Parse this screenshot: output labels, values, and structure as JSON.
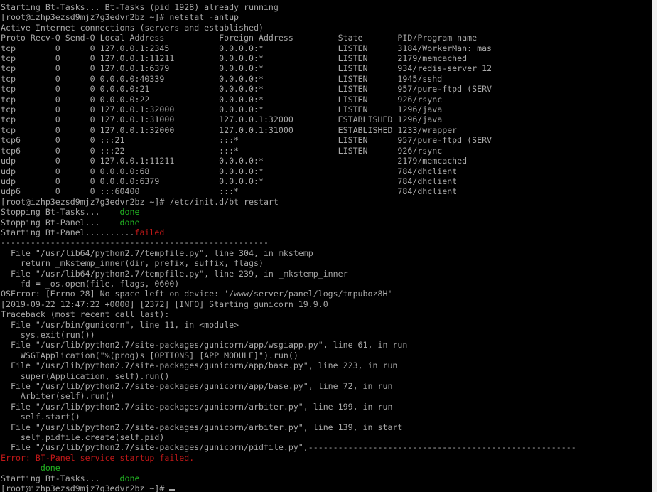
{
  "colors": {
    "background": "#000000",
    "default_text": "#a8a8a8",
    "green": "#22b222",
    "red": "#c01818"
  },
  "terminal": {
    "lines": [
      {
        "segments": [
          {
            "text": "Starting Bt-Tasks... Bt-Tasks (pid 1928) already running",
            "color": "default"
          }
        ]
      },
      {
        "segments": [
          {
            "text": "[root@izhp3ezsd9mjz7g3edvr2bz ~]# netstat -antup",
            "color": "default"
          }
        ]
      },
      {
        "segments": [
          {
            "text": "Active Internet connections (servers and established)",
            "color": "default"
          }
        ]
      },
      {
        "segments": [
          {
            "text": "Proto Recv-Q Send-Q Local Address           Foreign Address         State       PID/Program name",
            "color": "default"
          }
        ]
      },
      {
        "segments": [
          {
            "text": "tcp        0      0 127.0.0.1:2345          0.0.0.0:*               LISTEN      3184/WorkerMan: mas",
            "color": "default"
          }
        ]
      },
      {
        "segments": [
          {
            "text": "tcp        0      0 127.0.0.1:11211         0.0.0.0:*               LISTEN      2179/memcached",
            "color": "default"
          }
        ]
      },
      {
        "segments": [
          {
            "text": "tcp        0      0 127.0.0.1:6379          0.0.0.0:*               LISTEN      934/redis-server 12",
            "color": "default"
          }
        ]
      },
      {
        "segments": [
          {
            "text": "tcp        0      0 0.0.0.0:40339           0.0.0.0:*               LISTEN      1945/sshd",
            "color": "default"
          }
        ]
      },
      {
        "segments": [
          {
            "text": "tcp        0      0 0.0.0.0:21              0.0.0.0:*               LISTEN      957/pure-ftpd (SERV",
            "color": "default"
          }
        ]
      },
      {
        "segments": [
          {
            "text": "tcp        0      0 0.0.0.0:22              0.0.0.0:*               LISTEN      926/rsync",
            "color": "default"
          }
        ]
      },
      {
        "segments": [
          {
            "text": "tcp        0      0 127.0.0.1:32000         0.0.0.0:*               LISTEN      1296/java",
            "color": "default"
          }
        ]
      },
      {
        "segments": [
          {
            "text": "tcp        0      0 127.0.0.1:31000         127.0.0.1:32000         ESTABLISHED 1296/java",
            "color": "default"
          }
        ]
      },
      {
        "segments": [
          {
            "text": "tcp        0      0 127.0.0.1:32000         127.0.0.1:31000         ESTABLISHED 1233/wrapper",
            "color": "default"
          }
        ]
      },
      {
        "segments": [
          {
            "text": "tcp6       0      0 :::21                   :::*                    LISTEN      957/pure-ftpd (SERV",
            "color": "default"
          }
        ]
      },
      {
        "segments": [
          {
            "text": "tcp6       0      0 :::22                   :::*                    LISTEN      926/rsync",
            "color": "default"
          }
        ]
      },
      {
        "segments": [
          {
            "text": "udp        0      0 127.0.0.1:11211         0.0.0.0:*                           2179/memcached",
            "color": "default"
          }
        ]
      },
      {
        "segments": [
          {
            "text": "udp        0      0 0.0.0.0:68              0.0.0.0:*                           784/dhclient",
            "color": "default"
          }
        ]
      },
      {
        "segments": [
          {
            "text": "udp        0      0 0.0.0.0:6379            0.0.0.0:*                           784/dhclient",
            "color": "default"
          }
        ]
      },
      {
        "segments": [
          {
            "text": "udp6       0      0 :::60400                :::*                                784/dhclient",
            "color": "default"
          }
        ]
      },
      {
        "segments": [
          {
            "text": "[root@izhp3ezsd9mjz7g3edvr2bz ~]# /etc/init.d/bt restart",
            "color": "default"
          }
        ]
      },
      {
        "segments": [
          {
            "text": "Stopping Bt-Tasks...    ",
            "color": "default"
          },
          {
            "text": "done",
            "color": "green"
          }
        ]
      },
      {
        "segments": [
          {
            "text": "Stopping Bt-Panel...    ",
            "color": "default"
          },
          {
            "text": "done",
            "color": "green"
          }
        ]
      },
      {
        "segments": [
          {
            "text": "Starting Bt-Panel..........",
            "color": "default"
          },
          {
            "text": "failed",
            "color": "red"
          }
        ]
      },
      {
        "segments": [
          {
            "text": "------------------------------------------------------",
            "color": "default"
          }
        ]
      },
      {
        "segments": [
          {
            "text": "  File \"/usr/lib64/python2.7/tempfile.py\", line 304, in mkstemp",
            "color": "default"
          }
        ]
      },
      {
        "segments": [
          {
            "text": "    return _mkstemp_inner(dir, prefix, suffix, flags)",
            "color": "default"
          }
        ]
      },
      {
        "segments": [
          {
            "text": "  File \"/usr/lib64/python2.7/tempfile.py\", line 239, in _mkstemp_inner",
            "color": "default"
          }
        ]
      },
      {
        "segments": [
          {
            "text": "    fd = _os.open(file, flags, 0600)",
            "color": "default"
          }
        ]
      },
      {
        "segments": [
          {
            "text": "OSError: [Errno 28] No space left on device: '/www/server/panel/logs/tmpuboz8H'",
            "color": "default"
          }
        ]
      },
      {
        "segments": [
          {
            "text": "[2019-09-22 12:47:22 +0000] [2372] [INFO] Starting gunicorn 19.9.0",
            "color": "default"
          }
        ]
      },
      {
        "segments": [
          {
            "text": "Traceback (most recent call last):",
            "color": "default"
          }
        ]
      },
      {
        "segments": [
          {
            "text": "  File \"/usr/bin/gunicorn\", line 11, in <module>",
            "color": "default"
          }
        ]
      },
      {
        "segments": [
          {
            "text": "    sys.exit(run())",
            "color": "default"
          }
        ]
      },
      {
        "segments": [
          {
            "text": "  File \"/usr/lib/python2.7/site-packages/gunicorn/app/wsgiapp.py\", line 61, in run",
            "color": "default"
          }
        ]
      },
      {
        "segments": [
          {
            "text": "    WSGIApplication(\"%(prog)s [OPTIONS] [APP_MODULE]\").run()",
            "color": "default"
          }
        ]
      },
      {
        "segments": [
          {
            "text": "  File \"/usr/lib/python2.7/site-packages/gunicorn/app/base.py\", line 223, in run",
            "color": "default"
          }
        ]
      },
      {
        "segments": [
          {
            "text": "    super(Application, self).run()",
            "color": "default"
          }
        ]
      },
      {
        "segments": [
          {
            "text": "  File \"/usr/lib/python2.7/site-packages/gunicorn/app/base.py\", line 72, in run",
            "color": "default"
          }
        ]
      },
      {
        "segments": [
          {
            "text": "    Arbiter(self).run()",
            "color": "default"
          }
        ]
      },
      {
        "segments": [
          {
            "text": "  File \"/usr/lib/python2.7/site-packages/gunicorn/arbiter.py\", line 199, in run",
            "color": "default"
          }
        ]
      },
      {
        "segments": [
          {
            "text": "    self.start()",
            "color": "default"
          }
        ]
      },
      {
        "segments": [
          {
            "text": "  File \"/usr/lib/python2.7/site-packages/gunicorn/arbiter.py\", line 139, in start",
            "color": "default"
          }
        ]
      },
      {
        "segments": [
          {
            "text": "    self.pidfile.create(self.pid)",
            "color": "default"
          }
        ]
      },
      {
        "segments": [
          {
            "text": "  File \"/usr/lib/python2.7/site-packages/gunicorn/pidfile.py\",------------------------------------------------------",
            "color": "default"
          }
        ]
      },
      {
        "segments": [
          {
            "text": "Error: BT-Panel service startup failed.",
            "color": "red"
          }
        ]
      },
      {
        "segments": [
          {
            "text": "        done",
            "color": "green"
          }
        ]
      },
      {
        "segments": [
          {
            "text": "Starting Bt-Tasks...    ",
            "color": "default"
          },
          {
            "text": "done",
            "color": "green"
          }
        ]
      },
      {
        "segments": [
          {
            "text": "[root@izhp3ezsd9mjz7g3edvr2bz ~]# ",
            "color": "default"
          }
        ],
        "cursor": true
      }
    ]
  }
}
